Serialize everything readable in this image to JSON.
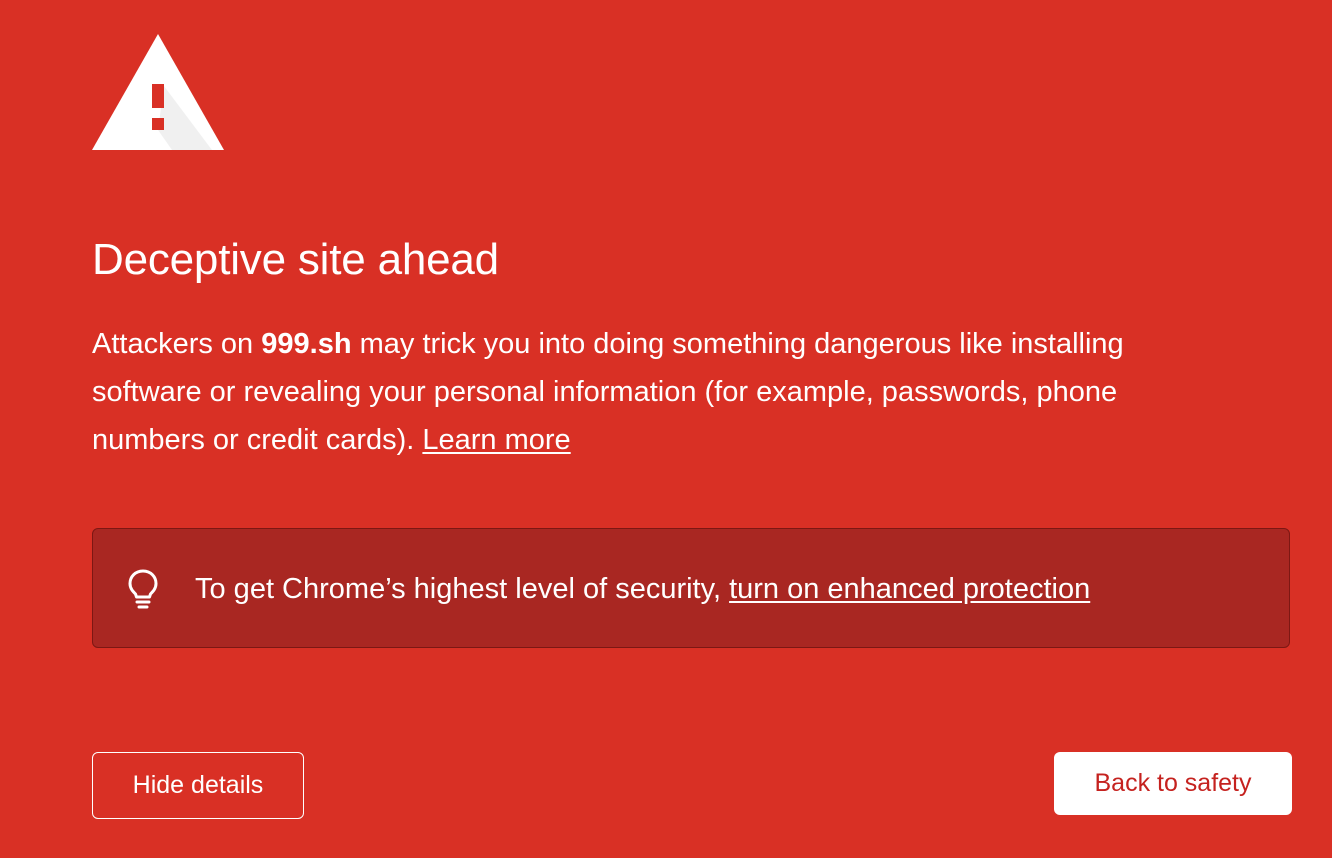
{
  "icons": {
    "warning": "warning-triangle-icon",
    "tip": "lightbulb-icon"
  },
  "colors": {
    "background": "#d93025",
    "security_box": "#a92722",
    "primary_button_text": "#c5221f"
  },
  "heading": "Deceptive site ahead",
  "body": {
    "part1": "Attackers on ",
    "domain": "999.sh",
    "part2": " may trick you into doing something dangerous like installing software or revealing your personal information (for example, passwords, phone numbers or credit cards). ",
    "learn_more": "Learn more"
  },
  "security_tip": {
    "text": "To get Chrome’s highest level of security, ",
    "link": "turn on enhanced protection"
  },
  "buttons": {
    "hide_details": "Hide details",
    "back_to_safety": "Back to safety"
  }
}
